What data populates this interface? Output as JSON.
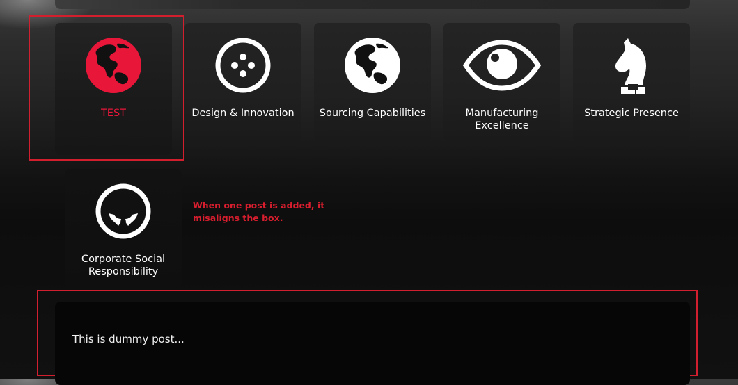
{
  "colors": {
    "accent": "#e8173a",
    "annotation": "#d81e2e",
    "tile_bg": "#202020",
    "text": "#ffffff"
  },
  "tiles": [
    {
      "label": "TEST",
      "icon": "globe-icon",
      "state": "active"
    },
    {
      "label": "Design & Innovation",
      "icon": "button-icon"
    },
    {
      "label": "Sourcing Capabilities",
      "icon": "globe-icon"
    },
    {
      "label": "Manufacturing Excellence",
      "icon": "eye-icon"
    },
    {
      "label": "Strategic Presence",
      "icon": "chess-knight-icon"
    },
    {
      "label": "Corporate Social Responsibility",
      "icon": "hands-circle-icon"
    }
  ],
  "annotation": {
    "text": "When one post is added, it misaligns the box."
  },
  "post": {
    "text": "This is dummy post..."
  }
}
